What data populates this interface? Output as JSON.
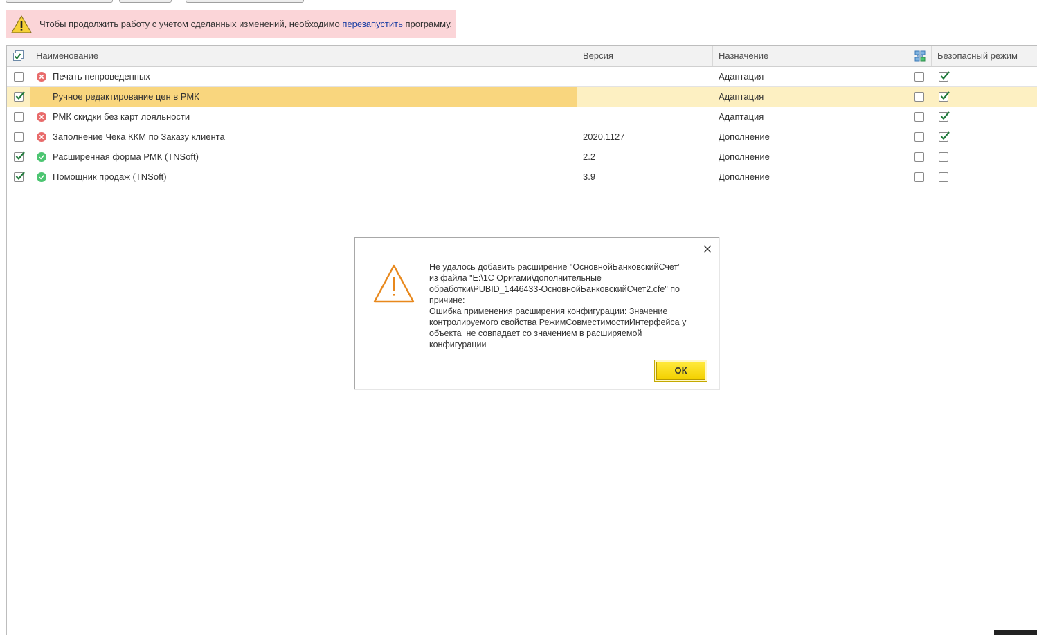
{
  "banner": {
    "text_before": "Чтобы продолжить работу с учетом сделанных изменений, необходимо ",
    "link": "перезапустить",
    "text_after": " программу.",
    "icon": "warning-icon"
  },
  "table": {
    "headers": {
      "name": "Наименование",
      "version": "Версия",
      "purpose": "Назначение",
      "safe_mode": "Безопасный режим"
    },
    "rows": [
      {
        "active": false,
        "status": "error",
        "name": "Печать непроведенных",
        "version": "",
        "purpose": "Адаптация",
        "flag": false,
        "safe_mode": true
      },
      {
        "active": true,
        "status": "ok",
        "name": "Ручное редактирование цен в РМК",
        "version": "",
        "purpose": "Адаптация",
        "flag": false,
        "safe_mode": true,
        "selected": true
      },
      {
        "active": false,
        "status": "error",
        "name": "РМК скидки без карт лояльности",
        "version": "",
        "purpose": "Адаптация",
        "flag": false,
        "safe_mode": true
      },
      {
        "active": false,
        "status": "error",
        "name": "Заполнение Чека ККМ по Заказу клиента",
        "version": "2020.1127",
        "purpose": "Дополнение",
        "flag": false,
        "safe_mode": true
      },
      {
        "active": true,
        "status": "ok",
        "name": "Расширенная форма РМК (TNSoft)",
        "version": "2.2",
        "purpose": "Дополнение",
        "flag": false,
        "safe_mode": false
      },
      {
        "active": true,
        "status": "ok",
        "name": "Помощник продаж (TNSoft)",
        "version": "3.9",
        "purpose": "Дополнение",
        "flag": false,
        "safe_mode": false
      }
    ]
  },
  "dialog": {
    "lines": [
      "Не удалось добавить расширение \"ОсновнойБанковскийСчет\"",
      "из файла \"E:\\1С Оригами\\дополнительные",
      "обработки\\PUBID_1446433-ОсновнойБанковскийСчет2.cfe\" по",
      "причине:",
      "Ошибка применения расширения конфигурации: Значение",
      "контролируемого свойства РежимСовместимостиИнтерфейса у",
      "объекта  не совпадает со значением в расширяемой",
      "конфигурации"
    ],
    "ok_label": "ОК"
  },
  "colors": {
    "banner_bg": "#fbd5d8",
    "selected_row": "#fdf0c2",
    "selected_cell": "#f9d67e",
    "ok_button": "#f3d100",
    "status_error": "#e86b6b",
    "status_ok": "#4cc571",
    "check": "#1f7a3a"
  }
}
